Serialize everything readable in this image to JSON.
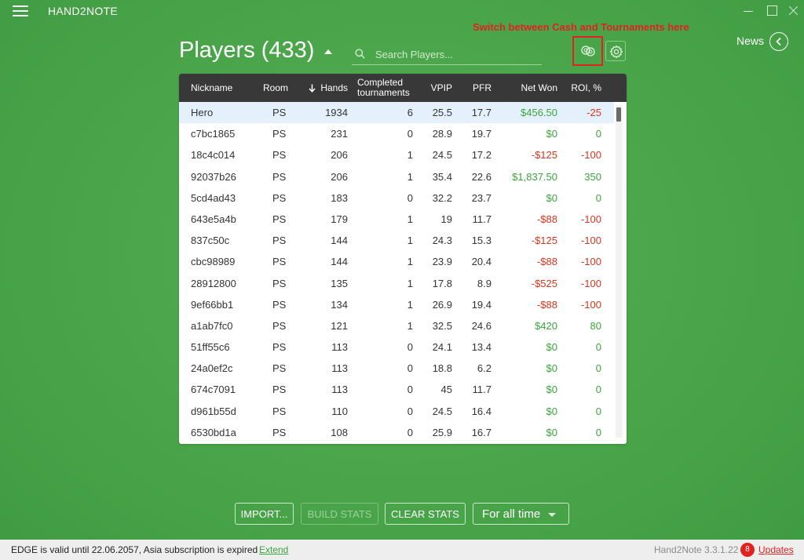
{
  "app": {
    "title": "HAND2NOTE",
    "version": "Hand2Note 3.3.1.22"
  },
  "header": {
    "title": "Players (433)",
    "search_placeholder": "Search Players...",
    "search_value": "",
    "annotation": "Switch between Cash and Tournaments here",
    "news_label": "News"
  },
  "table": {
    "columns": {
      "nickname": "Nickname",
      "room": "Room",
      "hands": "Hands",
      "completed": "Completed tournaments",
      "vpip": "VPIP",
      "pfr": "PFR",
      "net_won": "Net Won",
      "roi": "ROI, %"
    },
    "sort_column": "Hands",
    "rows": [
      {
        "nickname": "Hero",
        "room": "PS",
        "hands": "1934",
        "completed": "6",
        "vpip": "25.5",
        "pfr": "17.7",
        "net_won": "$456.50",
        "roi": "-25",
        "net_class": "pos",
        "roi_class": "neg"
      },
      {
        "nickname": "c7bc1865",
        "room": "PS",
        "hands": "231",
        "completed": "0",
        "vpip": "28.9",
        "pfr": "19.7",
        "net_won": "$0",
        "roi": "0",
        "net_class": "zero",
        "roi_class": "zero"
      },
      {
        "nickname": "18c4c014",
        "room": "PS",
        "hands": "206",
        "completed": "1",
        "vpip": "24.5",
        "pfr": "17.2",
        "net_won": "-$125",
        "roi": "-100",
        "net_class": "neg",
        "roi_class": "neg"
      },
      {
        "nickname": "92037b26",
        "room": "PS",
        "hands": "206",
        "completed": "1",
        "vpip": "35.4",
        "pfr": "22.6",
        "net_won": "$1,837.50",
        "roi": "350",
        "net_class": "pos",
        "roi_class": "pos"
      },
      {
        "nickname": "5cd4ad43",
        "room": "PS",
        "hands": "183",
        "completed": "0",
        "vpip": "32.2",
        "pfr": "23.7",
        "net_won": "$0",
        "roi": "0",
        "net_class": "zero",
        "roi_class": "zero"
      },
      {
        "nickname": "643e5a4b",
        "room": "PS",
        "hands": "179",
        "completed": "1",
        "vpip": "19",
        "pfr": "11.7",
        "net_won": "-$88",
        "roi": "-100",
        "net_class": "neg",
        "roi_class": "neg"
      },
      {
        "nickname": "837c50c",
        "room": "PS",
        "hands": "144",
        "completed": "1",
        "vpip": "24.3",
        "pfr": "15.3",
        "net_won": "-$125",
        "roi": "-100",
        "net_class": "neg",
        "roi_class": "neg"
      },
      {
        "nickname": "cbc98989",
        "room": "PS",
        "hands": "144",
        "completed": "1",
        "vpip": "23.9",
        "pfr": "20.4",
        "net_won": "-$88",
        "roi": "-100",
        "net_class": "neg",
        "roi_class": "neg"
      },
      {
        "nickname": "28912800",
        "room": "PS",
        "hands": "135",
        "completed": "1",
        "vpip": "17.8",
        "pfr": "8.9",
        "net_won": "-$525",
        "roi": "-100",
        "net_class": "neg",
        "roi_class": "neg"
      },
      {
        "nickname": "9ef66bb1",
        "room": "PS",
        "hands": "134",
        "completed": "1",
        "vpip": "26.9",
        "pfr": "19.4",
        "net_won": "-$88",
        "roi": "-100",
        "net_class": "neg",
        "roi_class": "neg"
      },
      {
        "nickname": "a1ab7fc0",
        "room": "PS",
        "hands": "121",
        "completed": "1",
        "vpip": "32.5",
        "pfr": "24.6",
        "net_won": "$420",
        "roi": "80",
        "net_class": "pos",
        "roi_class": "pos"
      },
      {
        "nickname": "51ff55c6",
        "room": "PS",
        "hands": "113",
        "completed": "0",
        "vpip": "24.1",
        "pfr": "13.4",
        "net_won": "$0",
        "roi": "0",
        "net_class": "zero",
        "roi_class": "zero"
      },
      {
        "nickname": "24a0ef2c",
        "room": "PS",
        "hands": "113",
        "completed": "0",
        "vpip": "18.8",
        "pfr": "6.2",
        "net_won": "$0",
        "roi": "0",
        "net_class": "zero",
        "roi_class": "zero"
      },
      {
        "nickname": "674c7091",
        "room": "PS",
        "hands": "113",
        "completed": "0",
        "vpip": "45",
        "pfr": "11.7",
        "net_won": "$0",
        "roi": "0",
        "net_class": "zero",
        "roi_class": "zero"
      },
      {
        "nickname": "d961b55d",
        "room": "PS",
        "hands": "110",
        "completed": "0",
        "vpip": "24.5",
        "pfr": "16.4",
        "net_won": "$0",
        "roi": "0",
        "net_class": "zero",
        "roi_class": "zero"
      },
      {
        "nickname": "6530bd1a",
        "room": "PS",
        "hands": "108",
        "completed": "0",
        "vpip": "25.9",
        "pfr": "16.7",
        "net_won": "$0",
        "roi": "0",
        "net_class": "zero",
        "roi_class": "zero"
      }
    ]
  },
  "actions": {
    "import": "IMPORT...",
    "build_stats": "BUILD STATS",
    "clear_stats": "CLEAR STATS",
    "time_filter": "For all time"
  },
  "status": {
    "text": "EDGE is valid until 22.06.2057,  Asia subscription is expired",
    "extend": "Extend",
    "updates_count": "8",
    "updates_label": "Updates"
  },
  "colors": {
    "background": "#4aa54a",
    "header_row": "#383838",
    "positive": "#3aa53a",
    "negative": "#d9341d",
    "annotation": "#e0231f",
    "selected_row": "#e4f0fb"
  },
  "icons": {
    "menu": "hamburger-icon",
    "search": "search-icon",
    "mode_switch": "cash-tournament-switch-icon",
    "settings": "gear-icon",
    "news": "chevron-left-circle-icon",
    "sort": "arrow-down-icon"
  }
}
